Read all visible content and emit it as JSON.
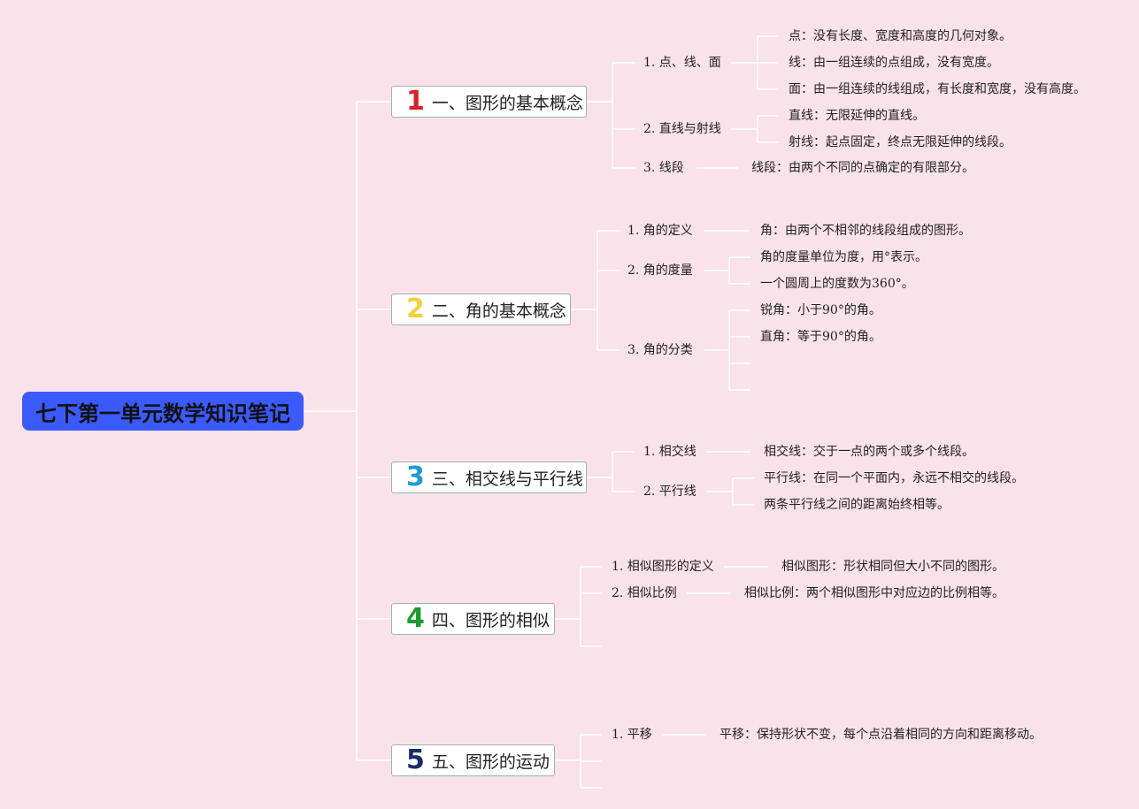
{
  "root": {
    "title": "七下第一单元数学知识笔记",
    "color": "#3a5afc"
  },
  "branches": [
    {
      "num": "1",
      "num_color": "#d8202a",
      "title": "一、图形的基本概念",
      "subs": [
        {
          "label": "1. 点、线、面",
          "leaves": [
            "点：没有长度、宽度和高度的几何对象。",
            "线：由一组连续的点组成，没有宽度。",
            "面：由一组连续的线组成，有长度和宽度，没有高度。"
          ]
        },
        {
          "label": "2. 直线与射线",
          "leaves": [
            "直线：无限延伸的直线。",
            "射线：起点固定，终点无限延伸的线段。"
          ]
        },
        {
          "label": "3. 线段",
          "leaves": [
            "线段：由两个不同的点确定的有限部分。"
          ]
        }
      ]
    },
    {
      "num": "2",
      "num_color": "#f0d23a",
      "title": "二、角的基本概念",
      "subs": [
        {
          "label": "1. 角的定义",
          "leaves": [
            "角：由两个不相邻的线段组成的图形。"
          ]
        },
        {
          "label": "2. 角的度量",
          "leaves": [
            "角的度量单位为度，用°表示。",
            "一个圆周上的度数为360°。"
          ]
        },
        {
          "label": "3. 角的分类",
          "leaves": [
            "锐角：小于90°的角。",
            "直角：等于90°的角。",
            "",
            ""
          ]
        }
      ]
    },
    {
      "num": "3",
      "num_color": "#1f9ad6",
      "title": "三、相交线与平行线",
      "subs": [
        {
          "label": "1. 相交线",
          "leaves": [
            "相交线：交于一点的两个或多个线段。"
          ]
        },
        {
          "label": "2. 平行线",
          "leaves": [
            "平行线：在同一个平面内，永远不相交的线段。",
            "两条平行线之间的距离始终相等。"
          ]
        }
      ]
    },
    {
      "num": "4",
      "num_color": "#1e9a2e",
      "title": "四、图形的相似",
      "subs": [
        {
          "label": "1. 相似图形的定义",
          "leaves": [
            "相似图形：形状相同但大小不同的图形。"
          ]
        },
        {
          "label": "2. 相似比例",
          "leaves": [
            "相似比例：两个相似图形中对应边的比例相等。"
          ]
        },
        {
          "label": "",
          "leaves": []
        }
      ]
    },
    {
      "num": "5",
      "num_color": "#1c2a6b",
      "title": "五、图形的运动",
      "subs": [
        {
          "label": "1. 平移",
          "leaves": [
            "平移：保持形状不变，每个点沿着相同的方向和距离移动。"
          ]
        },
        {
          "label": "",
          "leaves": []
        },
        {
          "label": "",
          "leaves": []
        }
      ]
    }
  ]
}
